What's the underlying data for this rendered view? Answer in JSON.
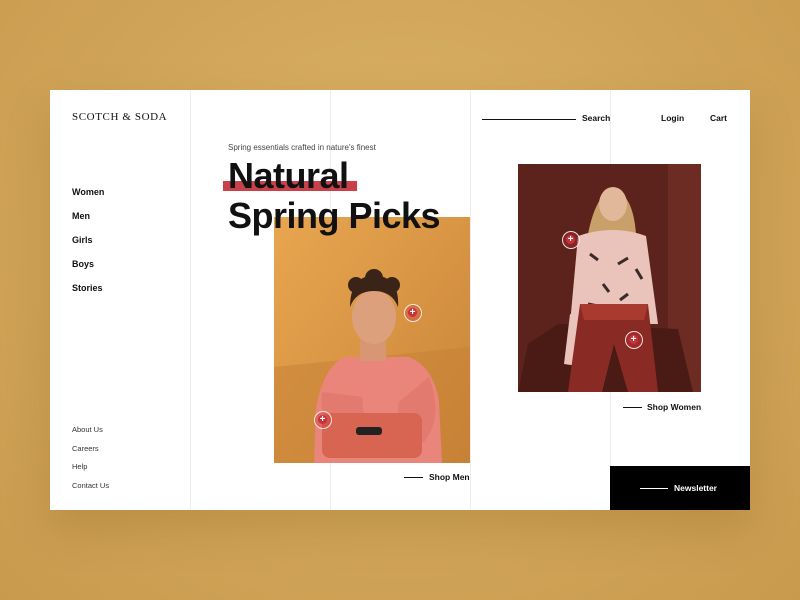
{
  "brand": {
    "logo_text": "SCOTCH & SODA"
  },
  "header": {
    "search_label": "Search",
    "login_label": "Login",
    "cart_label": "Cart"
  },
  "sidebar": {
    "nav": [
      {
        "label": "Women"
      },
      {
        "label": "Men"
      },
      {
        "label": "Girls"
      },
      {
        "label": "Boys"
      },
      {
        "label": "Stories"
      }
    ],
    "footer_links": [
      {
        "label": "About Us"
      },
      {
        "label": "Careers"
      },
      {
        "label": "Help"
      },
      {
        "label": "Contact Us"
      }
    ]
  },
  "hero": {
    "tagline": "Spring essentials crafted in nature's finest",
    "title_line1": "Natural",
    "title_line2": "Spring Picks",
    "highlight_color": "#c8414a"
  },
  "sections": {
    "men": {
      "cta": "Shop Men"
    },
    "women": {
      "cta": "Shop Women"
    }
  },
  "newsletter": {
    "label": "Newsletter"
  },
  "icons": {
    "hotspot": "plus-circle-icon"
  },
  "colors": {
    "background": "#d4a95c",
    "card": "#ffffff",
    "text": "#111111",
    "accent": "#c8414a"
  }
}
